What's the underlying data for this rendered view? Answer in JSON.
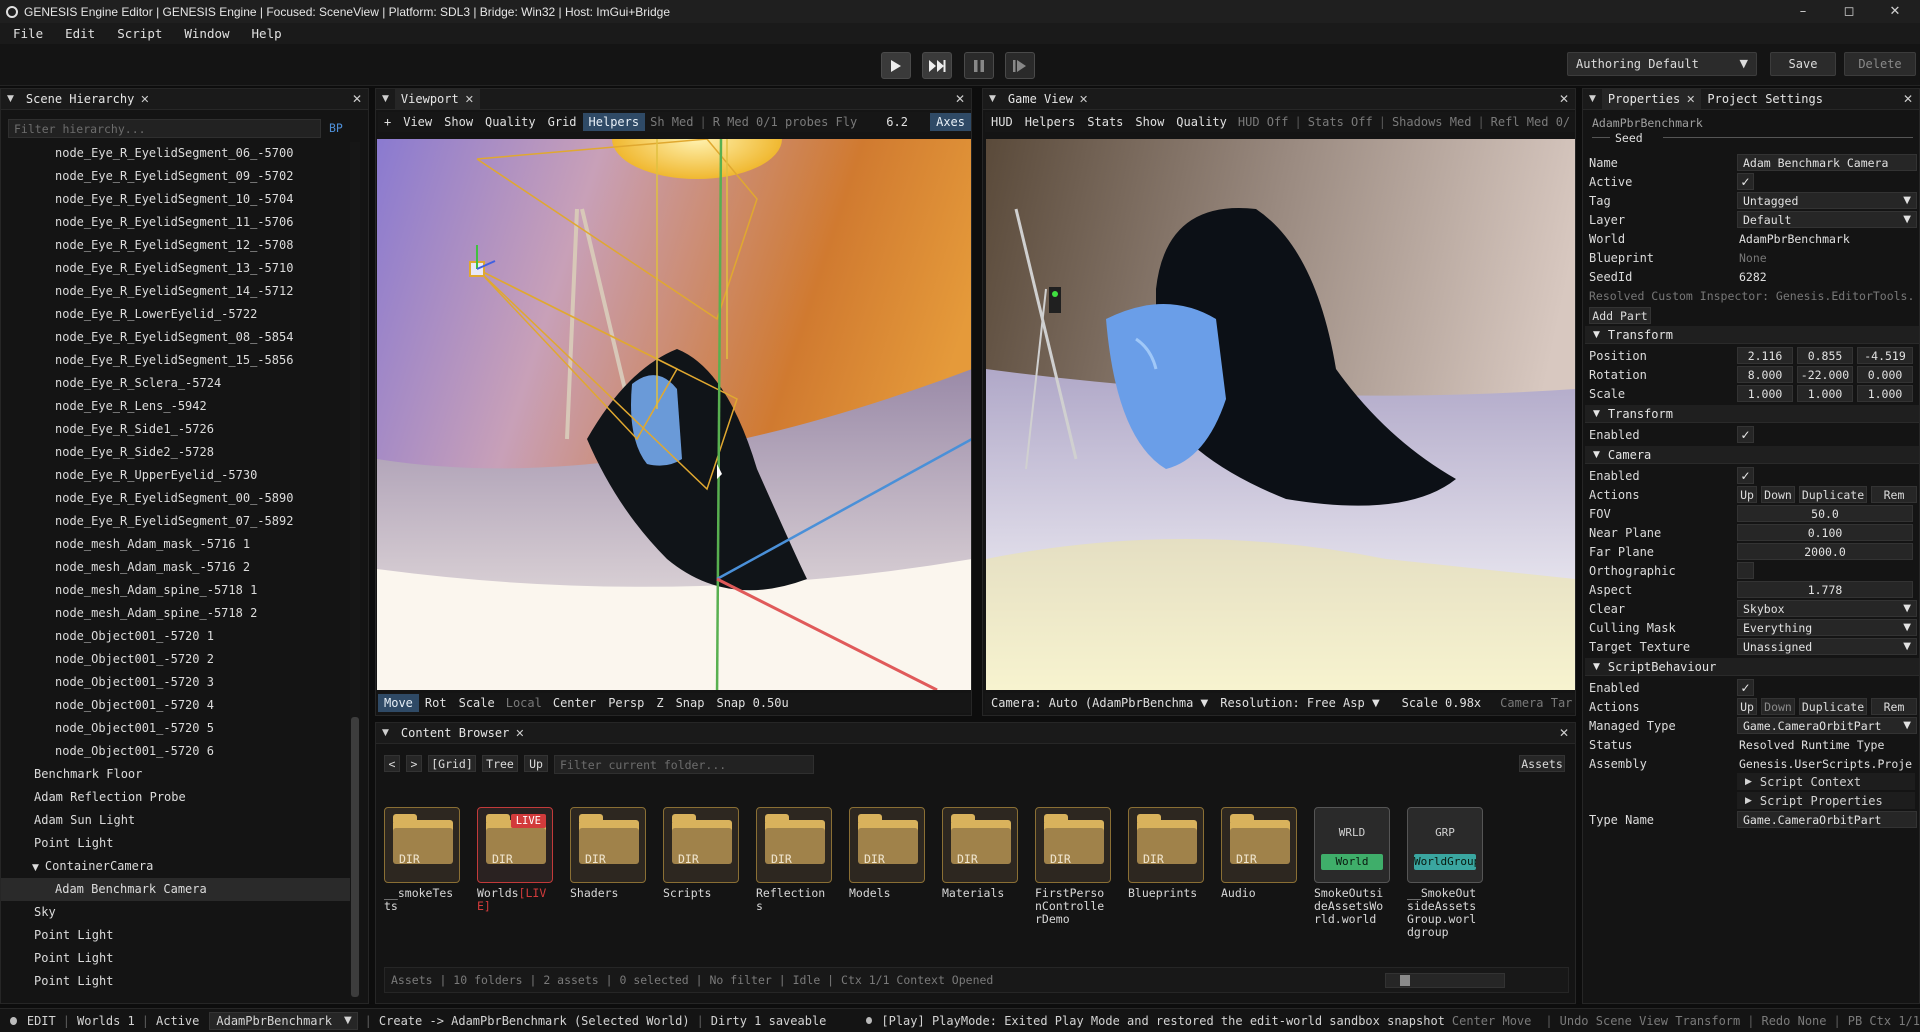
{
  "window": {
    "title": "GENESIS Engine Editor | GENESIS Engine | Focused: SceneView | Platform: SDL3 | Bridge: Win32 | Host: ImGui+Bridge",
    "controls": {
      "minimize": "–",
      "maximize": "◻",
      "close": "✕"
    }
  },
  "menu": [
    "File",
    "Edit",
    "Script",
    "Window",
    "Help"
  ],
  "toolbar": {
    "play_icon": "play-icon",
    "profile": "Authoring Default",
    "save_label": "Save",
    "delete_label": "Delete"
  },
  "hierarchy": {
    "tab": "Scene Hierarchy",
    "filter_placeholder": "Filter hierarchy...",
    "bp_label": "BP",
    "items": [
      {
        "label": "node_Eye_R_EyelidSegment_06_-5700",
        "depth": 2
      },
      {
        "label": "node_Eye_R_EyelidSegment_09_-5702",
        "depth": 2
      },
      {
        "label": "node_Eye_R_EyelidSegment_10_-5704",
        "depth": 2
      },
      {
        "label": "node_Eye_R_EyelidSegment_11_-5706",
        "depth": 2
      },
      {
        "label": "node_Eye_R_EyelidSegment_12_-5708",
        "depth": 2
      },
      {
        "label": "node_Eye_R_EyelidSegment_13_-5710",
        "depth": 2
      },
      {
        "label": "node_Eye_R_EyelidSegment_14_-5712",
        "depth": 2
      },
      {
        "label": "node_Eye_R_LowerEyelid_-5722",
        "depth": 2
      },
      {
        "label": "node_Eye_R_EyelidSegment_08_-5854",
        "depth": 2
      },
      {
        "label": "node_Eye_R_EyelidSegment_15_-5856",
        "depth": 2
      },
      {
        "label": "node_Eye_R_Sclera_-5724",
        "depth": 2
      },
      {
        "label": "node_Eye_R_Lens_-5942",
        "depth": 2
      },
      {
        "label": "node_Eye_R_Side1_-5726",
        "depth": 2
      },
      {
        "label": "node_Eye_R_Side2_-5728",
        "depth": 2
      },
      {
        "label": "node_Eye_R_UpperEyelid_-5730",
        "depth": 2
      },
      {
        "label": "node_Eye_R_EyelidSegment_00_-5890",
        "depth": 2
      },
      {
        "label": "node_Eye_R_EyelidSegment_07_-5892",
        "depth": 2
      },
      {
        "label": "node_mesh_Adam_mask_-5716 1",
        "depth": 2
      },
      {
        "label": "node_mesh_Adam_mask_-5716 2",
        "depth": 2
      },
      {
        "label": "node_mesh_Adam_spine_-5718 1",
        "depth": 2
      },
      {
        "label": "node_mesh_Adam_spine_-5718 2",
        "depth": 2
      },
      {
        "label": "node_Object001_-5720 1",
        "depth": 2
      },
      {
        "label": "node_Object001_-5720 2",
        "depth": 2
      },
      {
        "label": "node_Object001_-5720 3",
        "depth": 2
      },
      {
        "label": "node_Object001_-5720 4",
        "depth": 2
      },
      {
        "label": "node_Object001_-5720 5",
        "depth": 2
      },
      {
        "label": "node_Object001_-5720 6",
        "depth": 2
      },
      {
        "label": "Benchmark Floor",
        "depth": 1
      },
      {
        "label": "Adam Reflection Probe",
        "depth": 1
      },
      {
        "label": "Adam Sun Light",
        "depth": 1
      },
      {
        "label": "Point Light",
        "depth": 1
      },
      {
        "label": "ContainerCamera",
        "depth": 1,
        "expanded": true
      },
      {
        "label": "Adam Benchmark Camera",
        "depth": 2,
        "selected": true
      },
      {
        "label": "Sky",
        "depth": 1
      },
      {
        "label": "Point Light",
        "depth": 1
      },
      {
        "label": "Point Light",
        "depth": 1
      },
      {
        "label": "Point Light",
        "depth": 1
      }
    ]
  },
  "viewport": {
    "tab": "Viewport",
    "top_toolbar": [
      "+",
      "View",
      "Show",
      "Quality",
      "Grid",
      "Helpers"
    ],
    "top_dim": [
      "Sh Med",
      "R Med 0/1 probes Fly"
    ],
    "fov_value": "6.2",
    "axes_label": "Axes",
    "bottom_toolbar": [
      "Move",
      "Rot",
      "Scale",
      "Local",
      "Center",
      "Persp",
      "Z",
      "Snap",
      "Snap 0.50u"
    ]
  },
  "game_view": {
    "tab": "Game View",
    "top_toolbar": [
      "HUD",
      "Helpers",
      "Stats",
      "Show",
      "Quality"
    ],
    "top_dim": [
      "HUD Off",
      "Stats Off",
      "Shadows Med",
      "Refl Med 0/"
    ],
    "camera_label": "Camera: Auto (AdamPbrBenchma",
    "resolution_label": "Resolution: Free Asp",
    "scale_label": "Scale 0.98x",
    "camera_target": "Camera Tar"
  },
  "content_browser": {
    "tab": "Content Browser",
    "nav": [
      "<",
      ">",
      "[Grid]",
      "Tree",
      "Up"
    ],
    "filter_placeholder": "Filter current folder...",
    "assets_button": "Assets",
    "items": [
      {
        "kind": "DIR",
        "name": "__smokeTests"
      },
      {
        "kind": "DIR",
        "name": "Worlds",
        "badge": "LIVE",
        "suffix": "[LIVE]"
      },
      {
        "kind": "DIR",
        "name": "Shaders"
      },
      {
        "kind": "DIR",
        "name": "Scripts"
      },
      {
        "kind": "DIR",
        "name": "Reflections"
      },
      {
        "kind": "DIR",
        "name": "Models"
      },
      {
        "kind": "DIR",
        "name": "Materials"
      },
      {
        "kind": "DIR",
        "name": "FirstPersonControllerDemo"
      },
      {
        "kind": "DIR",
        "name": "Blueprints"
      },
      {
        "kind": "DIR",
        "name": "Audio"
      },
      {
        "kind": "WRLD",
        "tag": "World",
        "name": "SmokeOutsideAssetsWorld.world"
      },
      {
        "kind": "GRP",
        "tag": "WorldGroup",
        "name": "__SmokeOutsideAssetsGroup.worldgroup"
      }
    ],
    "status": "Assets | 10 folders | 2 assets | 0 selected | No filter | Idle | Ctx 1/1 Context Opened"
  },
  "properties": {
    "tabs": [
      "Properties",
      "Project Settings"
    ],
    "object_name": "AdamPbrBenchmark",
    "seed_label": "Seed",
    "rows": {
      "name": {
        "label": "Name",
        "value": "Adam Benchmark Camera"
      },
      "active": {
        "label": "Active"
      },
      "tag": {
        "label": "Tag",
        "value": "Untagged"
      },
      "layer": {
        "label": "Layer",
        "value": "Default"
      },
      "world": {
        "label": "World",
        "value": "AdamPbrBenchmark"
      },
      "blueprint": {
        "label": "Blueprint",
        "value": "None"
      },
      "seedid": {
        "label": "SeedId",
        "value": "6282"
      }
    },
    "resolved_inspector": "Resolved Custom Inspector: Genesis.EditorTools.",
    "add_part": "Add Part",
    "transform": {
      "title": "Transform",
      "position_label": "Position",
      "position": [
        "2.116",
        "0.855",
        "-4.519"
      ],
      "rotation_label": "Rotation",
      "rotation": [
        "8.000",
        "-22.000",
        "0.000"
      ],
      "scale_label": "Scale",
      "scale": [
        "1.000",
        "1.000",
        "1.000"
      ]
    },
    "transform2": {
      "title": "Transform",
      "enabled_label": "Enabled"
    },
    "camera": {
      "title": "Camera",
      "enabled_label": "Enabled",
      "actions_label": "Actions",
      "actions": [
        "Up",
        "Down",
        "Duplicate",
        "Rem"
      ],
      "fov_label": "FOV",
      "fov": "50.0",
      "near_label": "Near Plane",
      "near": "0.100",
      "far_label": "Far Plane",
      "far": "2000.0",
      "ortho_label": "Orthographic",
      "aspect_label": "Aspect",
      "aspect": "1.778",
      "clear_label": "Clear",
      "clear": "Skybox",
      "culling_label": "Culling Mask",
      "culling": "Everything",
      "target_label": "Target Texture",
      "target": "Unassigned"
    },
    "script": {
      "title": "ScriptBehaviour",
      "enabled_label": "Enabled",
      "actions_label": "Actions",
      "actions": [
        "Up",
        "Down",
        "Duplicate",
        "Rem"
      ],
      "managed_label": "Managed Type",
      "managed": "Game.CameraOrbitPart",
      "status_label": "Status",
      "status": "Resolved Runtime Type",
      "assembly_label": "Assembly",
      "assembly": "Genesis.UserScripts.Proje",
      "context_label": "Script Context",
      "props_label": "Script Properties",
      "typename_label": "Type Name",
      "typename": "Game.CameraOrbitPart"
    }
  },
  "statusbar": {
    "mode": "EDIT",
    "worlds": "Worlds 1",
    "active": "Active",
    "world_select": "AdamPbrBenchmark",
    "create": "Create -> AdamPbrBenchmark (Selected World)",
    "dirty": "Dirty 1 saveable",
    "message": "[Play] PlayMode: Exited Play Mode and restored the edit-world sandbox snapshot",
    "center": "Center Move",
    "undo": "Undo Scene View Transform",
    "redo": "Redo None",
    "pb": "PB Ctx 1/1"
  },
  "colors": {
    "accent_blue": "#2f4a66",
    "folder": "#d9b25c",
    "live_red": "#d23b3b",
    "world_green": "#3fae6a",
    "group_teal": "#3aa6a0"
  }
}
